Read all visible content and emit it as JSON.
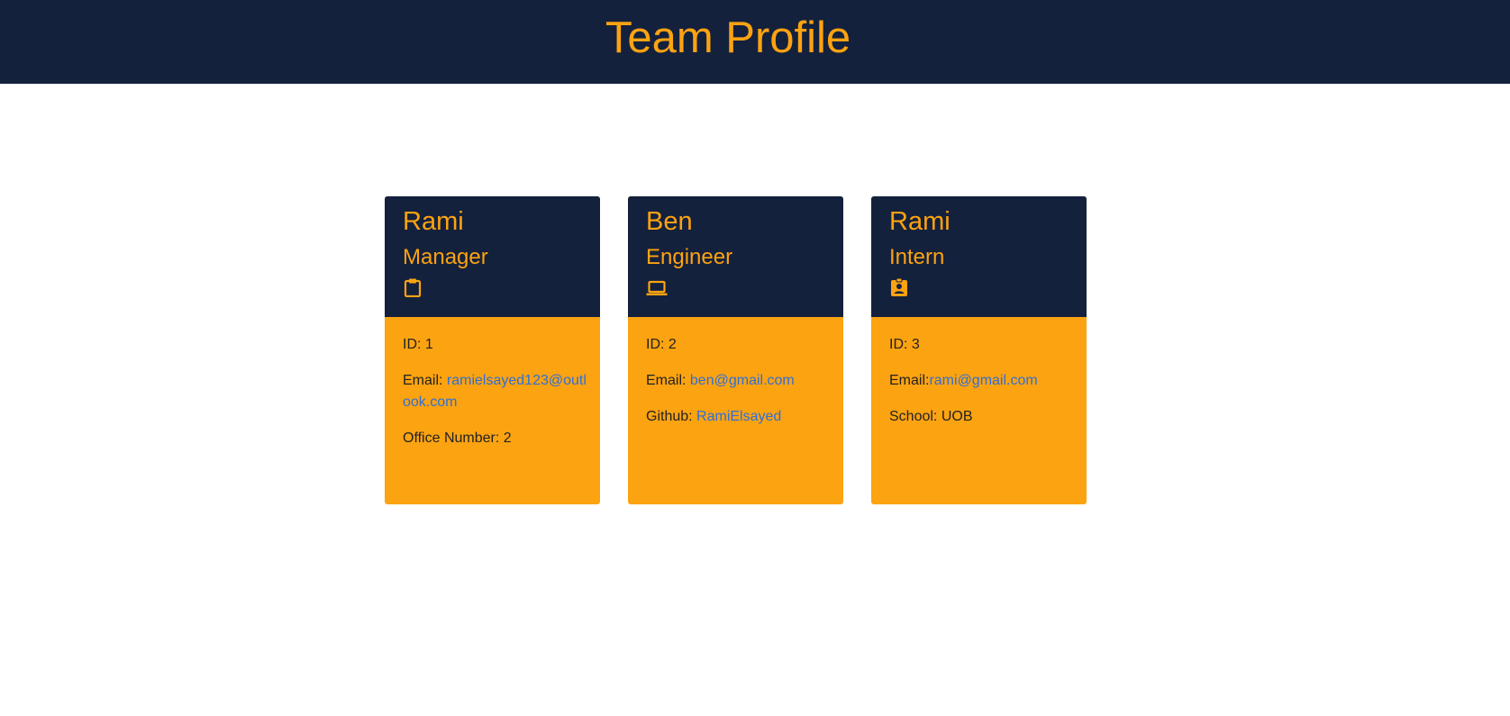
{
  "header": {
    "title": "Team Profile"
  },
  "theme": {
    "navy": "#14213d",
    "orange": "#fca311",
    "link": "#2f6fd6"
  },
  "cards": [
    {
      "name": "Rami",
      "role": "Manager",
      "icon": "clipboard-icon",
      "id_label": "ID: 1",
      "email_label": "Email:",
      "email": "ramielsayed123@outlook.com",
      "extra_label": "Office Number: 2",
      "extra_value": ""
    },
    {
      "name": "Ben",
      "role": "Engineer",
      "icon": "laptop-icon",
      "id_label": "ID: 2",
      "email_label": "Email: ",
      "email": "ben@gmail.com",
      "extra_label": "Github: ",
      "extra_value": "RamiElsayed"
    },
    {
      "name": "Rami",
      "role": "Intern",
      "icon": "badge-icon",
      "id_label": "ID: 3",
      "email_label": "Email:",
      "email": "rami@gmail.com",
      "extra_label": "School: UOB",
      "extra_value": ""
    }
  ]
}
